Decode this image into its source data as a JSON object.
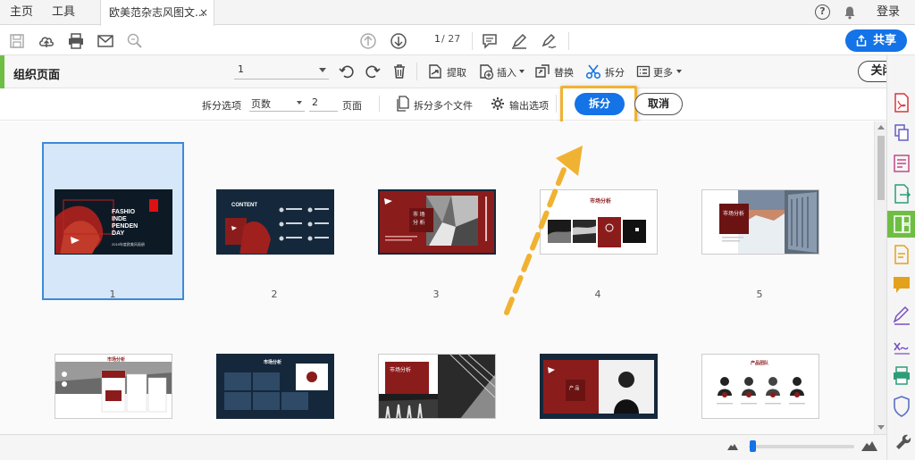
{
  "menubar": {
    "home": "主页",
    "tools": "工具",
    "doc_tab": "欧美范杂志风图文...",
    "close_tab": "×",
    "help": "?",
    "login": "登录"
  },
  "toolbar": {
    "page_current": "1",
    "page_total": "/ 27",
    "share_label": "共享"
  },
  "organize": {
    "title": "组织页面",
    "page_select": "1",
    "extract": "提取",
    "insert": "插入",
    "replace": "替换",
    "split": "拆分",
    "more": "更多",
    "close": "关闭"
  },
  "split_options": {
    "label": "拆分选项",
    "mode": "页数",
    "count": "2",
    "unit": "页面",
    "multi_files": "拆分多个文件",
    "output": "输出选项",
    "split_button": "拆分",
    "cancel_button": "取消"
  },
  "thumbnails": [
    {
      "page": "1",
      "selected": true
    },
    {
      "page": "2"
    },
    {
      "page": "3"
    },
    {
      "page": "4"
    },
    {
      "page": "5"
    }
  ],
  "slide_text": {
    "s1_lines": [
      "FASHIO",
      "INDE",
      "PENDEN",
      "DAY"
    ],
    "s1_sub": "2019年度欧美风画册",
    "s2_title": "CONTENT",
    "s3_title": "市 场",
    "s3_sub": "分 析",
    "s4_title": "市场分析",
    "s5_title": "市场分析",
    "r2_2_title": "市场分析",
    "r2_3_title": "市场分析",
    "r2_4_title": "产 品",
    "r2_5_title": "产品团队",
    "r2_1_title": "市场分析"
  },
  "colors": {
    "accent": "#1473e6",
    "green": "#6fbe44",
    "highlight": "#f0b232",
    "brand_red": "#8b1c1c",
    "navy": "#15283b"
  }
}
